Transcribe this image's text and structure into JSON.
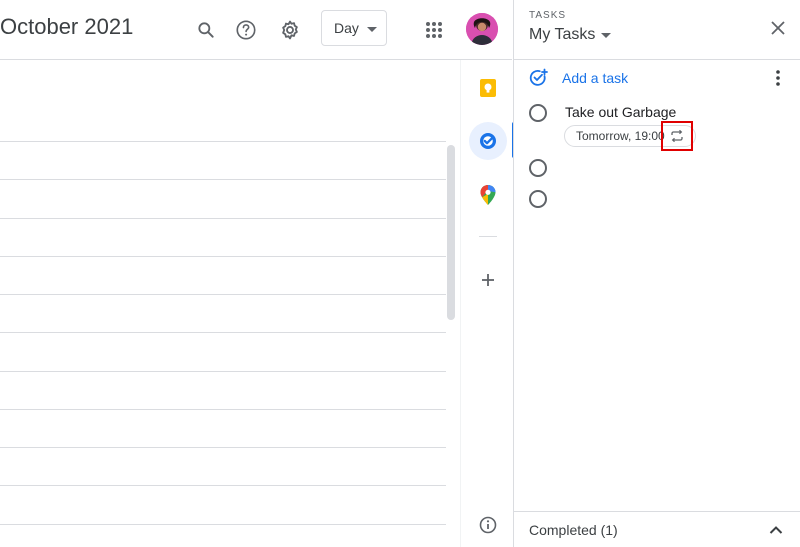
{
  "header": {
    "title": "October 2021",
    "search_icon": "search-icon",
    "help_icon": "help-icon",
    "settings_icon": "gear-icon",
    "view_select": "Day",
    "apps_icon": "apps-grid-icon"
  },
  "rail": {
    "items": [
      {
        "name": "keep",
        "icon": "keep-icon",
        "color": "#fbbc04"
      },
      {
        "name": "tasks",
        "icon": "tasks-icon",
        "color": "#1a73e8",
        "active": true
      },
      {
        "name": "maps",
        "icon": "maps-pin-icon",
        "color": "#34a853"
      }
    ],
    "add_icon": "plus-icon",
    "info_icon": "info-icon"
  },
  "tasks": {
    "eyebrow": "TASKS",
    "list_title": "My Tasks",
    "add_task_label": "Add a task",
    "items": [
      {
        "title": "Take out Garbage",
        "due": "Tomorrow, 19:00",
        "repeats": true
      },
      {
        "title": ""
      },
      {
        "title": ""
      }
    ],
    "completed_label": "Completed (1)"
  },
  "colors": {
    "accent": "#1a73e8",
    "highlight_box": "#e00000",
    "divider": "#dadce0"
  }
}
